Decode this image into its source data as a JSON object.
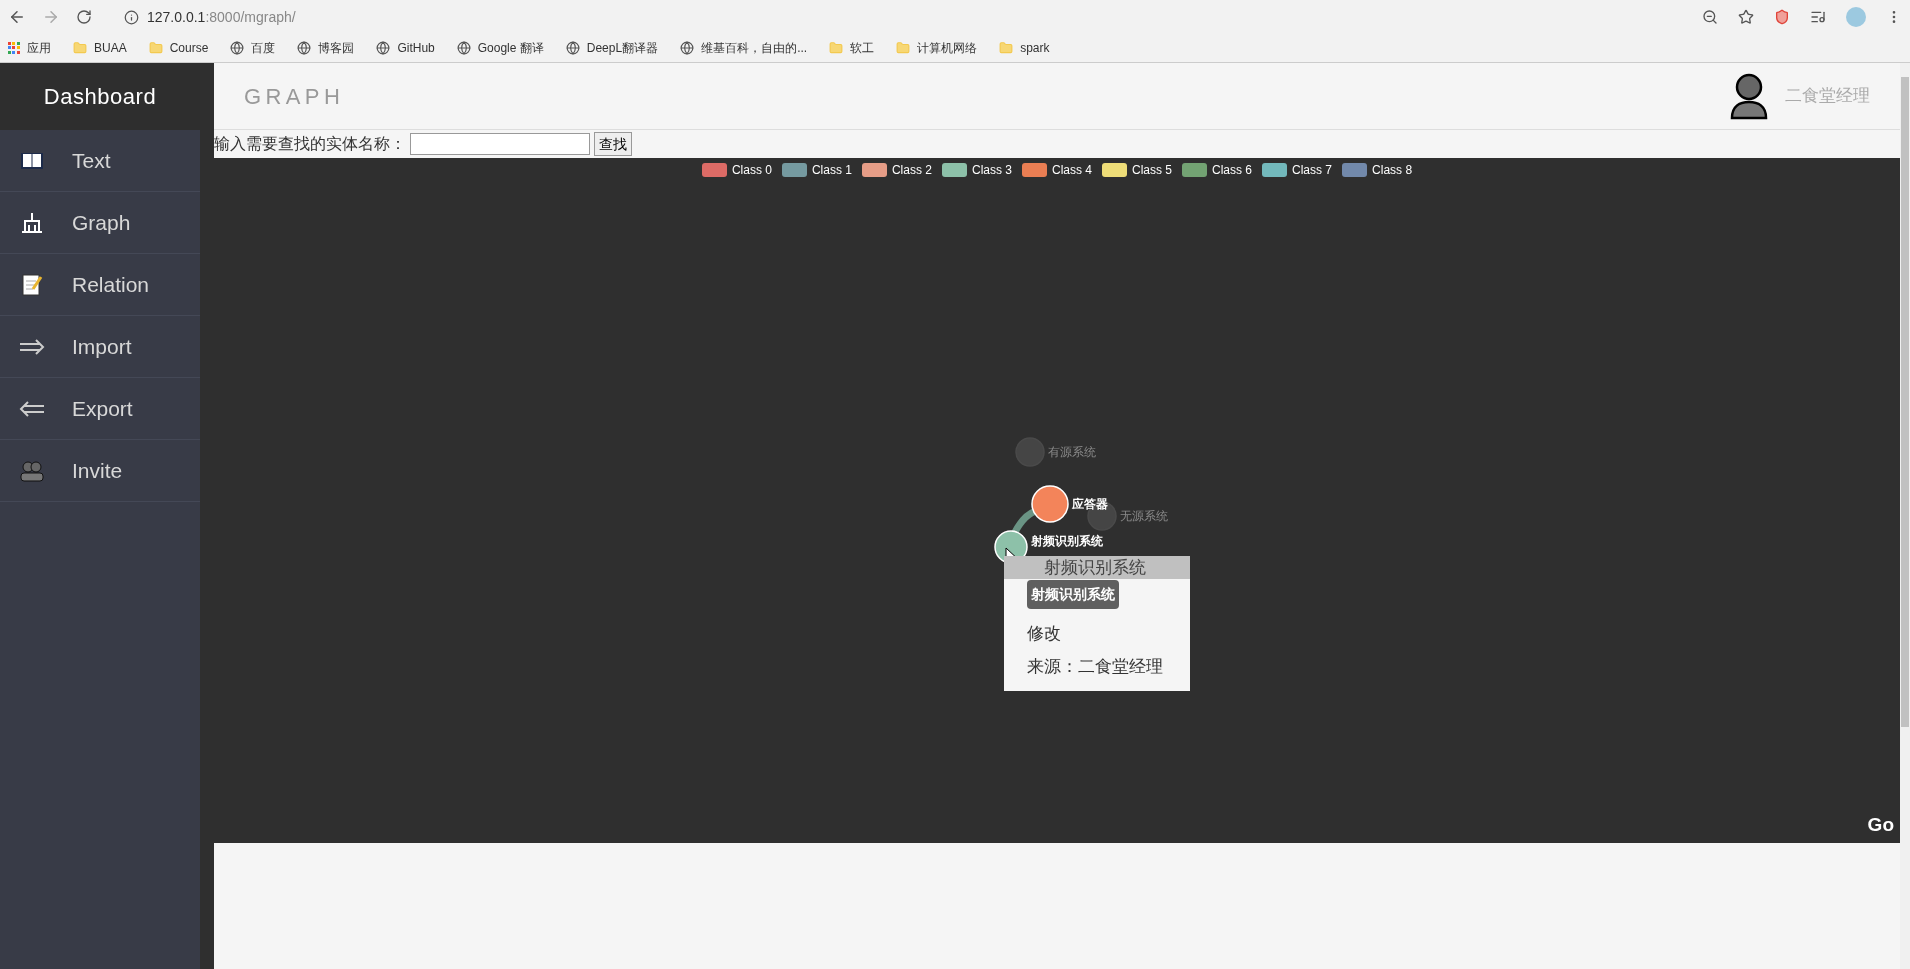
{
  "browser": {
    "url_host": "127.0.0.1",
    "url_rest": ":8000/mgraph/",
    "bookmarks": [
      {
        "label": "应用",
        "kind": "apps"
      },
      {
        "label": "BUAA",
        "kind": "folder"
      },
      {
        "label": "Course",
        "kind": "folder"
      },
      {
        "label": "百度",
        "kind": "site"
      },
      {
        "label": "博客园",
        "kind": "site"
      },
      {
        "label": "GitHub",
        "kind": "site"
      },
      {
        "label": "Google 翻译",
        "kind": "site"
      },
      {
        "label": "DeepL翻译器",
        "kind": "site"
      },
      {
        "label": "维基百科，自由的...",
        "kind": "site"
      },
      {
        "label": "软工",
        "kind": "folder"
      },
      {
        "label": "计算机网络",
        "kind": "folder"
      },
      {
        "label": "spark",
        "kind": "folder"
      }
    ]
  },
  "sidebar": {
    "title": "Dashboard",
    "items": [
      {
        "label": "Text"
      },
      {
        "label": "Graph"
      },
      {
        "label": "Relation"
      },
      {
        "label": "Import"
      },
      {
        "label": "Export"
      },
      {
        "label": "Invite"
      }
    ]
  },
  "header": {
    "title": "GRAPH",
    "user": "二食堂经理"
  },
  "search": {
    "label": "输入需要查找的实体名称：",
    "button": "查找"
  },
  "graph": {
    "legend": [
      {
        "label": "Class 0",
        "color": "#dd6b66"
      },
      {
        "label": "Class 1",
        "color": "#759aa0"
      },
      {
        "label": "Class 2",
        "color": "#e69d87"
      },
      {
        "label": "Class 3",
        "color": "#8dc1a9"
      },
      {
        "label": "Class 4",
        "color": "#ea7e53"
      },
      {
        "label": "Class 5",
        "color": "#eedd78"
      },
      {
        "label": "Class 6",
        "color": "#73a373"
      },
      {
        "label": "Class 7",
        "color": "#73b9bc"
      },
      {
        "label": "Class 8",
        "color": "#7289ab"
      }
    ],
    "nodes": [
      {
        "label": "有源系统",
        "dimmed": true
      },
      {
        "label": "应答器",
        "color": "#f3845a",
        "dimmed": false
      },
      {
        "label": "无源系统",
        "dimmed": true
      },
      {
        "label": "射频识别系统",
        "color": "#8dc1a9",
        "dimmed": false
      }
    ],
    "context_menu": {
      "title": "射频识别系统",
      "tooltip": "射频识别系统",
      "items": [
        "修改",
        "来源：二食堂经理"
      ]
    },
    "go": "Go"
  }
}
